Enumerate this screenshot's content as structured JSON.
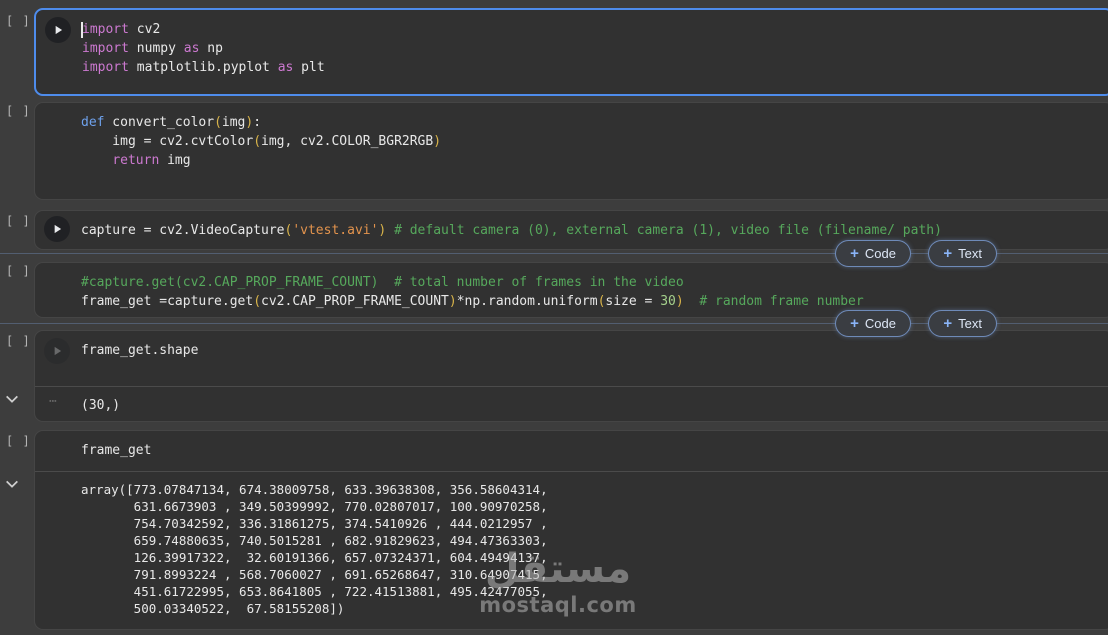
{
  "app": "notebook",
  "colors": {
    "page-bg": "#3d3d3d",
    "cell-bg": "#313131",
    "cell-border": "#454545",
    "selected-border": "#4e8cec",
    "accent-blue": "#8ab4f8",
    "divider": "#4b4b4b",
    "gutter-text": "#b4b4b4",
    "tok-plain": "#e8e8e8",
    "tok-keyword": "#cc79d0",
    "tok-defkw": "#6ea1ec",
    "tok-string": "#e2934d",
    "tok-comment": "#56a85c",
    "tok-bracket": "#d9b44a",
    "tok-number": "#a5d18c",
    "output-text": "#e8e8e8",
    "watermark": "#b5b5b5"
  },
  "gutter": {
    "empty_marker": "[ ]"
  },
  "add_buttons": {
    "plus": "+",
    "code": "Code",
    "text": "Text"
  },
  "watermark": {
    "logo": "مستقل",
    "site": "mostaql.com"
  },
  "cells": [
    {
      "type": "code",
      "selected": true,
      "lines": [
        [
          {
            "t": "import",
            "c": "k"
          },
          {
            "t": " cv2",
            "c": "p"
          }
        ],
        [
          {
            "t": "import",
            "c": "k"
          },
          {
            "t": " numpy ",
            "c": "p"
          },
          {
            "t": "as",
            "c": "k"
          },
          {
            "t": " np",
            "c": "p"
          }
        ],
        [
          {
            "t": "import",
            "c": "k"
          },
          {
            "t": " matplotlib.pyplot ",
            "c": "p"
          },
          {
            "t": "as",
            "c": "k"
          },
          {
            "t": " plt",
            "c": "p"
          }
        ]
      ]
    },
    {
      "type": "code",
      "lines": [
        [
          {
            "t": "def",
            "c": "d"
          },
          {
            "t": " convert_color",
            "c": "p"
          },
          {
            "t": "(",
            "c": "b"
          },
          {
            "t": "img",
            "c": "p"
          },
          {
            "t": ")",
            "c": "b"
          },
          {
            "t": ":",
            "c": "p"
          }
        ],
        [
          {
            "t": "    img = cv2.cvtColor",
            "c": "p"
          },
          {
            "t": "(",
            "c": "b"
          },
          {
            "t": "img, cv2.COLOR_BGR2RGB",
            "c": "p"
          },
          {
            "t": ")",
            "c": "b"
          }
        ],
        [
          {
            "t": "    ",
            "c": "p"
          },
          {
            "t": "return",
            "c": "k"
          },
          {
            "t": " img",
            "c": "p"
          }
        ],
        [
          {
            "t": "",
            "c": "p"
          }
        ]
      ]
    },
    {
      "type": "code",
      "lines": [
        [
          {
            "t": "capture = cv2.VideoCapture",
            "c": "p"
          },
          {
            "t": "(",
            "c": "b"
          },
          {
            "t": "'vtest.avi'",
            "c": "s"
          },
          {
            "t": ")",
            "c": "b"
          },
          {
            "t": " ",
            "c": "p"
          },
          {
            "t": "# default camera (0), external camera (1), video file (filename/ path)",
            "c": "c"
          }
        ]
      ]
    },
    {
      "type": "code",
      "lines": [
        [
          {
            "t": "#capture.get(cv2.CAP_PROP_FRAME_COUNT)  # total number of frames in the video",
            "c": "c"
          }
        ],
        [
          {
            "t": "frame_get =capture.get",
            "c": "p"
          },
          {
            "t": "(",
            "c": "b"
          },
          {
            "t": "cv2.CAP_PROP_FRAME_COUNT",
            "c": "p"
          },
          {
            "t": ")",
            "c": "b"
          },
          {
            "t": "*np.random.uniform",
            "c": "p"
          },
          {
            "t": "(",
            "c": "b"
          },
          {
            "t": "size = ",
            "c": "p"
          },
          {
            "t": "30",
            "c": "n"
          },
          {
            "t": ")",
            "c": "b"
          },
          {
            "t": "  ",
            "c": "p"
          },
          {
            "t": "# random frame number",
            "c": "c"
          }
        ]
      ]
    },
    {
      "type": "code",
      "lines": [
        [
          {
            "t": "frame_get.shape",
            "c": "p"
          }
        ]
      ],
      "output": "(30,)"
    },
    {
      "type": "code",
      "lines": [
        [
          {
            "t": "frame_get",
            "c": "p"
          }
        ]
      ],
      "output": "array([773.07847134, 674.38009758, 633.39638308, 356.58604314,\n       631.6673903 , 349.50399992, 770.02807017, 100.90970258,\n       754.70342592, 336.31861275, 374.5410926 , 444.0212957 ,\n       659.74880635, 740.5015281 , 682.91829623, 494.47363303,\n       126.39917322,  32.60191366, 657.07324371, 604.49494137,\n       791.8993224 , 568.7060027 , 691.65268647, 310.64907415,\n       451.61722995, 653.8641805 , 722.41513881, 495.42477055,\n       500.03340522,  67.58155208])"
    }
  ]
}
